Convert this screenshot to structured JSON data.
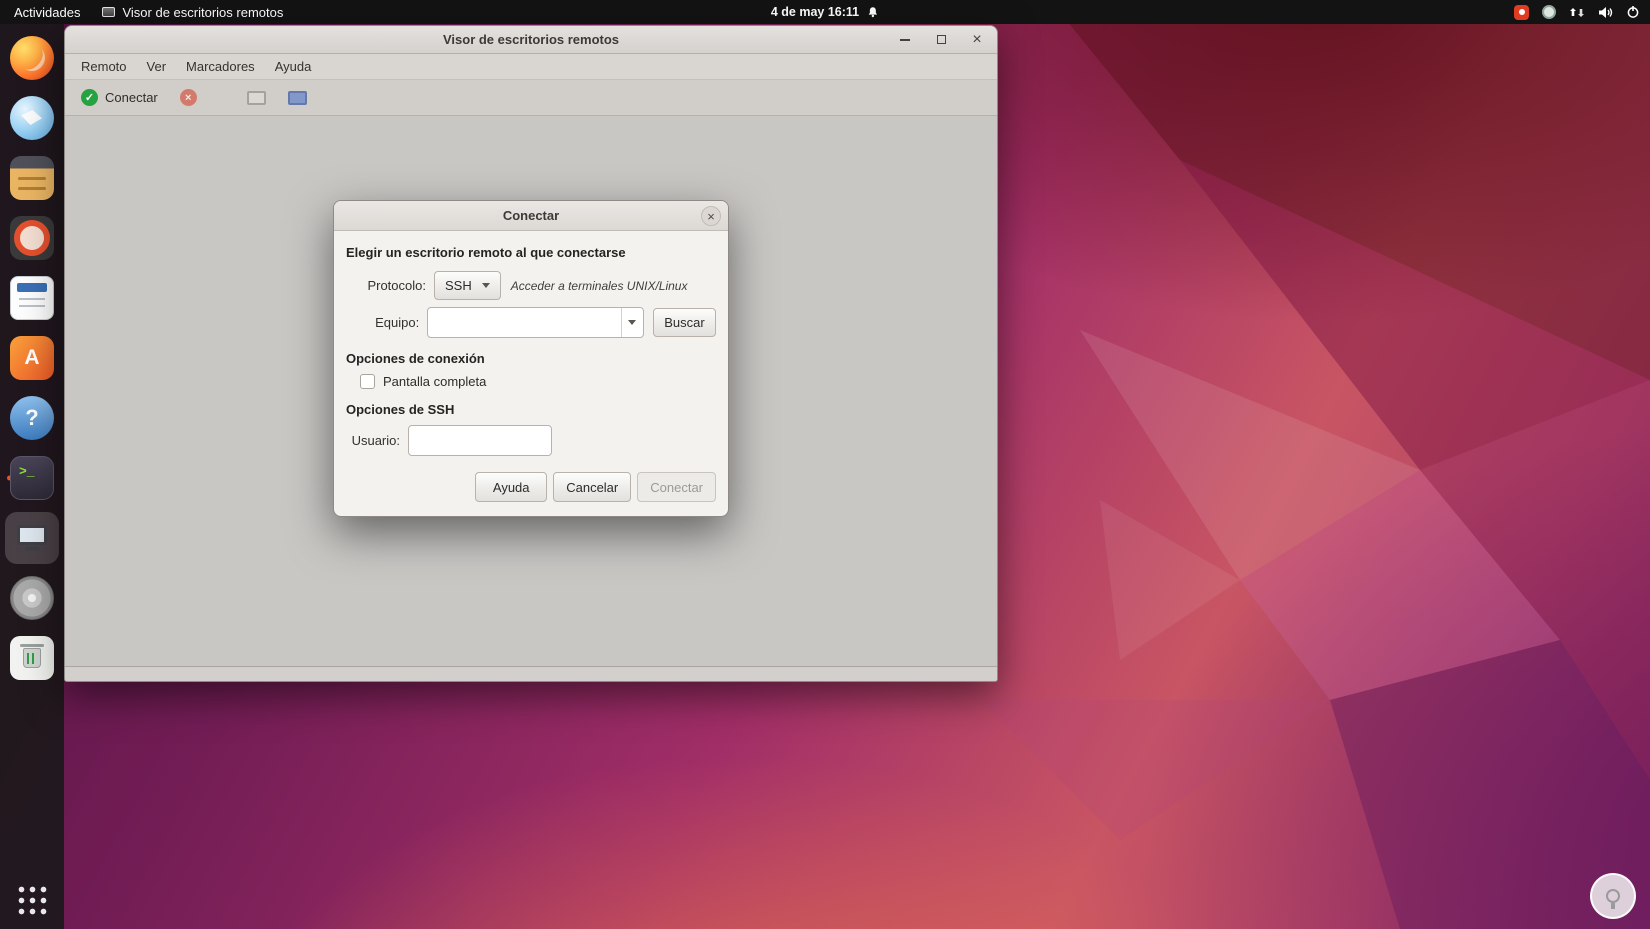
{
  "topbar": {
    "activities": "Actividades",
    "focused_app": "Visor de escritorios remotos",
    "clock": "4 de may 16:11"
  },
  "dock": {
    "items": [
      "firefox",
      "thunderbird",
      "files",
      "rhythmbox",
      "libreoffice-writer",
      "ubuntu-software",
      "help",
      "terminal",
      "remote-desktop-viewer",
      "disks",
      "trash",
      "show-applications"
    ],
    "glyphs": {
      "software": "A",
      "help": "?",
      "terminal": ">_"
    }
  },
  "window": {
    "title": "Visor de escritorios remotos",
    "controls": {
      "close": "×"
    },
    "menus": [
      "Remoto",
      "Ver",
      "Marcadores",
      "Ayuda"
    ],
    "toolbar": {
      "connect": "Conectar",
      "connect_glyph": "✓",
      "disconnect_glyph": "×"
    }
  },
  "dialog": {
    "title": "Conectar",
    "close_glyph": "×",
    "heading": "Elegir un escritorio remoto al que conectarse",
    "protocol": {
      "label": "Protocolo:",
      "value": "SSH",
      "hint": "Acceder a terminales UNIX/Linux"
    },
    "host": {
      "label": "Equipo:",
      "value": "",
      "find_button": "Buscar"
    },
    "connection_options": {
      "heading": "Opciones de conexión",
      "fullscreen_label": "Pantalla completa",
      "fullscreen_checked": false
    },
    "ssh_options": {
      "heading": "Opciones de SSH",
      "username_label": "Usuario:",
      "username_value": ""
    },
    "actions": {
      "help": "Ayuda",
      "cancel": "Cancelar",
      "connect": "Conectar"
    }
  },
  "colors": {
    "accent_orange": "#e95420",
    "connect_green": "#26a341",
    "disconnect_red": "#d7442f",
    "wallpaper_magenta": "#a12e67"
  }
}
